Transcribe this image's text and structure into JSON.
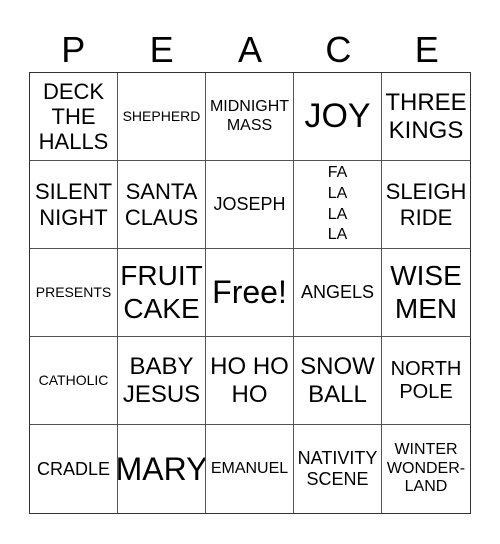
{
  "header": {
    "letters": [
      "P",
      "E",
      "A",
      "C",
      "E"
    ]
  },
  "cells": [
    "DECK THE HALLS",
    "SHEPHERD",
    "MIDNIGHT MASS",
    "JOY",
    "THREE KINGS",
    "SILENT NIGHT",
    "SANTA CLAUS",
    "JOSEPH",
    "FA LA LA LA",
    "SLEIGH RIDE",
    "PRESENTS",
    "FRUIT CAKE",
    "Free!",
    "ANGELS",
    "WISE MEN",
    "CATHOLIC",
    "BABY JESUS",
    "HO HO HO",
    "SNOW BALL",
    "NORTH POLE",
    "CRADLE",
    "MARY",
    "EMANUEL",
    "NATIVITY SCENE",
    "WINTER WONDER-LAND"
  ],
  "display": {
    "c0": [
      "DECK",
      "THE",
      "HALLS"
    ],
    "c2": [
      "MIDNIGHT",
      "MASS"
    ],
    "c4": [
      "THREE",
      "KINGS"
    ],
    "c5": [
      "SILENT",
      "NIGHT"
    ],
    "c6": [
      "SANTA",
      "CLAUS"
    ],
    "c8": [
      "FA",
      "LA",
      "LA",
      "LA"
    ],
    "c9": [
      "SLEIGH",
      "RIDE"
    ],
    "c11": [
      "FRUIT",
      "CAKE"
    ],
    "c14": [
      "WISE",
      "MEN"
    ],
    "c16": [
      "BABY",
      "JESUS"
    ],
    "c17": [
      "HO HO",
      "HO"
    ],
    "c18": [
      "SNOW",
      "BALL"
    ],
    "c19": [
      "NORTH",
      "POLE"
    ],
    "c23": [
      "NATIVITY",
      "SCENE"
    ],
    "c24": [
      "WINTER",
      "WONDER-",
      "LAND"
    ]
  }
}
